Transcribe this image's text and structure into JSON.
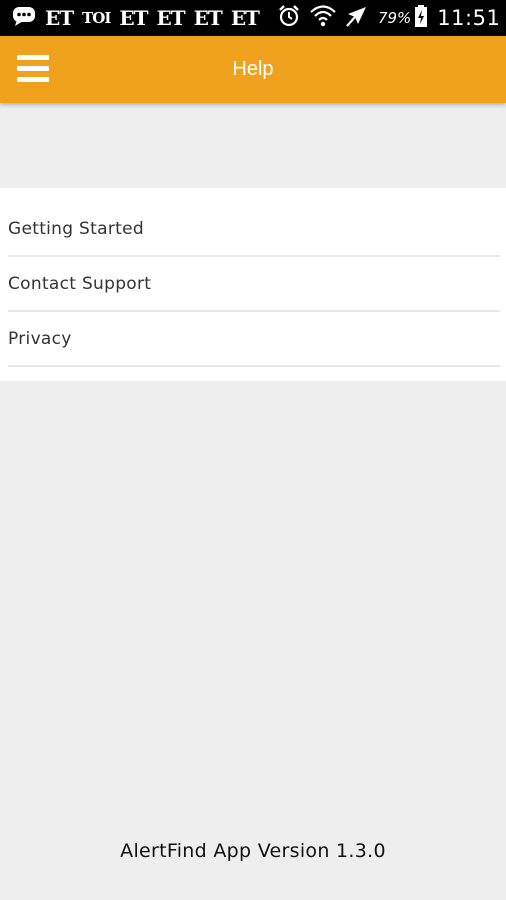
{
  "status_bar": {
    "notifications": [
      "ET",
      "TOI",
      "ET",
      "ET",
      "ET",
      "ET"
    ],
    "battery": "79%",
    "time": "11:51",
    "icons": [
      "chat-icon",
      "alarm-icon",
      "wifi-icon",
      "airplane-mode-icon",
      "battery-charging-icon"
    ]
  },
  "app_bar": {
    "title": "Help",
    "menu_icon": "hamburger-menu-icon",
    "color": "#f0a21f"
  },
  "help": {
    "items": [
      {
        "label": "Getting Started"
      },
      {
        "label": "Contact Support"
      },
      {
        "label": "Privacy"
      }
    ]
  },
  "footer": {
    "version": "AlertFind App Version 1.3.0"
  }
}
